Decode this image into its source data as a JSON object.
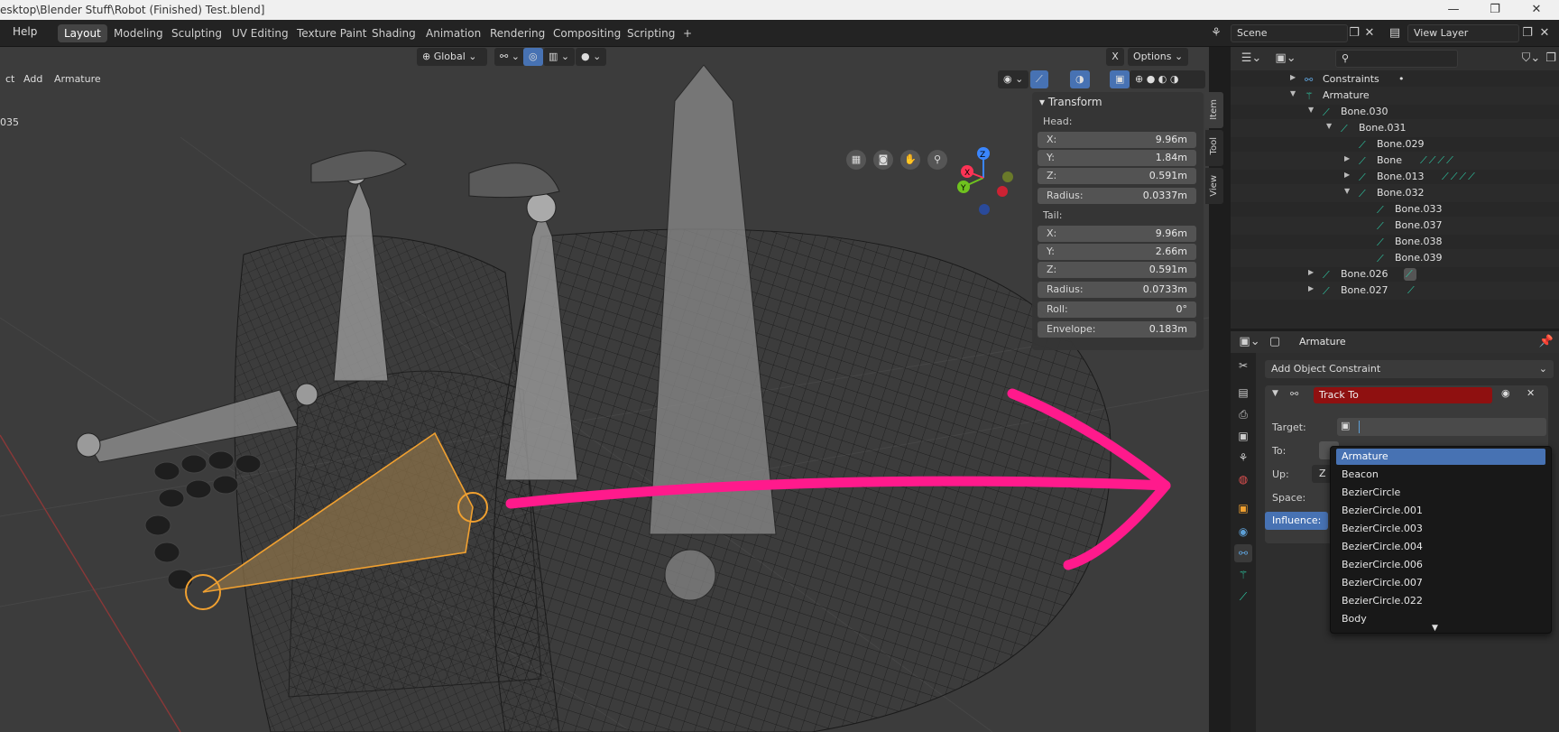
{
  "window": {
    "title": "esktop\\Blender Stuff\\Robot (Finished) Test.blend]",
    "controls": [
      "—",
      "❐",
      "✕"
    ]
  },
  "topbar": {
    "menus": [
      "Help"
    ],
    "workspaces": [
      "Layout",
      "Modeling",
      "Sculpting",
      "UV Editing",
      "Texture Paint",
      "Shading",
      "Animation",
      "Rendering",
      "Compositing",
      "Scripting"
    ],
    "active_workspace": "Layout",
    "add_tab": "+",
    "scene_label": "Scene",
    "view_layer_label": "View Layer"
  },
  "viewport": {
    "header_menus": [
      "ct",
      "Add",
      "Armature"
    ],
    "orientation": "Global",
    "options_label": "Options",
    "close_label": "X",
    "overlay_text": "035",
    "gizmo_axes": [
      "X",
      "Y",
      "Z"
    ]
  },
  "npanel": {
    "section": "Transform",
    "head_label": "Head:",
    "head": [
      {
        "label": "X:",
        "value": "9.96m"
      },
      {
        "label": "Y:",
        "value": "1.84m"
      },
      {
        "label": "Z:",
        "value": "0.591m"
      }
    ],
    "head_radius": {
      "label": "Radius:",
      "value": "0.0337m"
    },
    "tail_label": "Tail:",
    "tail": [
      {
        "label": "X:",
        "value": "9.96m"
      },
      {
        "label": "Y:",
        "value": "2.66m"
      },
      {
        "label": "Z:",
        "value": "0.591m"
      }
    ],
    "tail_radius": {
      "label": "Radius:",
      "value": "0.0733m"
    },
    "roll": {
      "label": "Roll:",
      "value": "0°"
    },
    "envelope": {
      "label": "Envelope:",
      "value": "0.183m"
    },
    "tabs": [
      "Item",
      "Tool",
      "View"
    ]
  },
  "outliner": {
    "search_placeholder": "",
    "rows": [
      {
        "name": "Constraints",
        "extra": "•"
      },
      {
        "name": "Armature",
        "extra": ""
      },
      {
        "name": "Bone.030",
        "extra": ""
      },
      {
        "name": "Bone.031",
        "extra": ""
      },
      {
        "name": "Bone.029",
        "extra": ""
      },
      {
        "name": "Bone",
        "extra": "⟋⟋⟋⟋"
      },
      {
        "name": "Bone.013",
        "extra": "⟋⟋⟋⟋"
      },
      {
        "name": "Bone.032",
        "extra": ""
      },
      {
        "name": "Bone.033",
        "extra": ""
      },
      {
        "name": "Bone.037",
        "extra": ""
      },
      {
        "name": "Bone.038",
        "extra": ""
      },
      {
        "name": "Bone.039",
        "extra": ""
      },
      {
        "name": "Bone.026",
        "extra": ""
      },
      {
        "name": "Bone.027",
        "extra": ""
      }
    ]
  },
  "properties": {
    "object_name": "Armature",
    "add_constraint": "Add Object Constraint",
    "constraint_name": "Track To",
    "target_label": "Target:",
    "to_label": "To:",
    "up_label": "Up:",
    "up_value": "Z",
    "space_label": "Space:",
    "influence_label": "Influence:"
  },
  "dropdown": {
    "items": [
      "Armature",
      "Beacon",
      "BezierCircle",
      "BezierCircle.001",
      "BezierCircle.003",
      "BezierCircle.004",
      "BezierCircle.006",
      "BezierCircle.007",
      "BezierCircle.022",
      "Body"
    ],
    "selected": "Armature",
    "more": "▼"
  },
  "colors": {
    "accent": "#4772b3",
    "constraint_red": "#8f1010",
    "selection_orange": "#f0a030",
    "annotation_pink": "#ff1a8c",
    "bone_teal": "#2ecfa8"
  }
}
